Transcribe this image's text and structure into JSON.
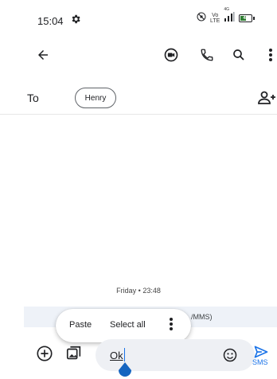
{
  "status": {
    "time": "15:04",
    "lte_top": "Vo",
    "lte_bottom": "LTE",
    "network": "4G",
    "battery": "43",
    "battery_level": 0.43
  },
  "appbar": {
    "icons": [
      "back-arrow-icon",
      "video-call-icon",
      "phone-icon",
      "search-icon",
      "more-vert-icon"
    ]
  },
  "recipient": {
    "to_label": "To",
    "chip": "Henry"
  },
  "conversation": {
    "date": "Friday • 23:48",
    "band_text": "/MMS)"
  },
  "context_menu": {
    "paste": "Paste",
    "select_all": "Select all"
  },
  "composer": {
    "text": "Ok",
    "send_label": "SMS"
  },
  "colors": {
    "accent": "#1a73e8",
    "battery": "#2e7d32",
    "band": "#eef2f8",
    "input_bg": "#eef0f4"
  }
}
